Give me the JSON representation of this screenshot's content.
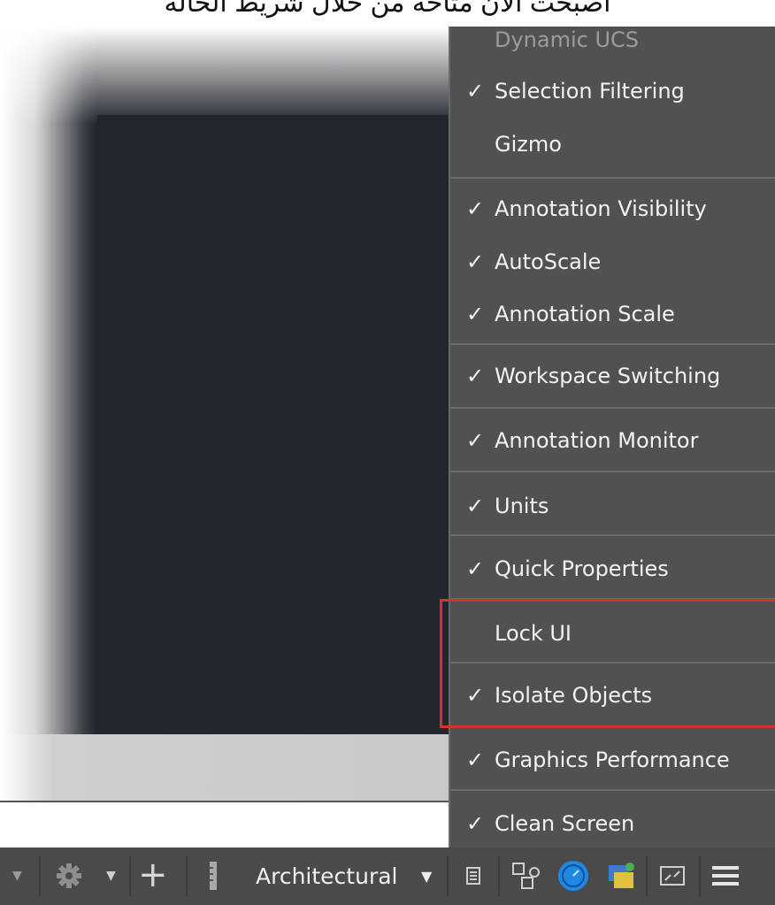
{
  "caption": "أصبحت الآن متاحة من خلال شريط الحالة",
  "menu": {
    "items": [
      {
        "label": "Dynamic UCS",
        "checked": false,
        "disabled": true
      },
      {
        "label": "Selection Filtering",
        "checked": true
      },
      {
        "label": "Gizmo",
        "checked": false
      },
      {
        "label": "Annotation Visibility",
        "checked": true
      },
      {
        "label": "AutoScale",
        "checked": true
      },
      {
        "label": "Annotation Scale",
        "checked": true
      },
      {
        "label": "Workspace Switching",
        "checked": true
      },
      {
        "label": "Annotation Monitor",
        "checked": true
      },
      {
        "label": "Units",
        "checked": true
      },
      {
        "label": "Quick Properties",
        "checked": true
      },
      {
        "label": "Lock UI",
        "checked": false
      },
      {
        "label": "Isolate Objects",
        "checked": true
      },
      {
        "label": "Graphics Performance",
        "checked": true
      },
      {
        "label": "Clean Screen",
        "checked": true
      }
    ],
    "check_glyph": "✓"
  },
  "statusbar": {
    "units_label": "Architectural",
    "dropdown_glyph": "▼",
    "plus_glyph": "+",
    "menu_glyph": "☰",
    "icons": [
      "gear-icon",
      "crosshair-icon",
      "ruler-icon",
      "quick-properties-icon",
      "selection-cycling-icon",
      "hardware-acceleration-icon",
      "isolate-objects-icon",
      "clean-screen-icon",
      "customization-menu-icon"
    ]
  },
  "colors": {
    "menu_bg": "#515151",
    "highlight": "#d9302f",
    "viewport": "#22262d",
    "statusbar": "#4a4a4a",
    "accent_blue": "#1e88e5"
  }
}
